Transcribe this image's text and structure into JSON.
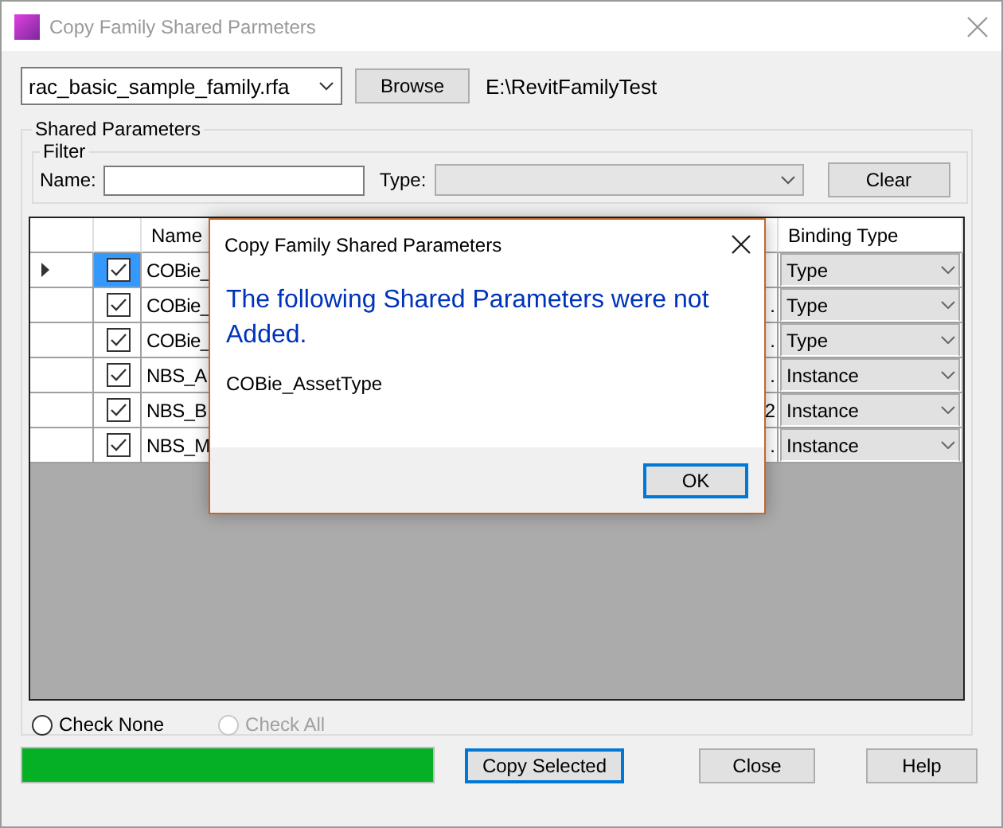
{
  "window": {
    "title": "Copy Family Shared Parmeters"
  },
  "file_select": {
    "value": "rac_basic_sample_family.rfa"
  },
  "browse_button": "Browse",
  "path": "E:\\RevitFamilyTest",
  "shared_parameters": {
    "title": "Shared Parameters",
    "filter": {
      "title": "Filter",
      "name_label": "Name:",
      "type_label": "Type:",
      "clear_button": "Clear"
    },
    "table": {
      "columns": [
        "Name",
        "Binding Type"
      ],
      "rows": [
        {
          "current": true,
          "selected": true,
          "checked": true,
          "name": "COBie_",
          "binding_type": "Type"
        },
        {
          "current": false,
          "selected": false,
          "checked": true,
          "name": "COBie_",
          "column_3": ".",
          "binding_type": "Type"
        },
        {
          "current": false,
          "selected": false,
          "checked": true,
          "name": "COBie_",
          "column_3": ".",
          "binding_type": "Type"
        },
        {
          "current": false,
          "selected": false,
          "checked": true,
          "name": "NBS_A",
          "column_3": ".",
          "binding_type": "Instance"
        },
        {
          "current": false,
          "selected": false,
          "checked": true,
          "name": "NBS_B",
          "column_3": "2",
          "binding_type": "Instance"
        },
        {
          "current": false,
          "selected": false,
          "checked": true,
          "name": "NBS_M",
          "column_3": ".",
          "binding_type": "Instance"
        }
      ]
    },
    "options": [
      {
        "label": "Check None",
        "selected": false,
        "disabled": false
      },
      {
        "label": "Check All",
        "selected": false,
        "disabled": true
      }
    ]
  },
  "progress": {
    "level": 1
  },
  "buttons": [
    {
      "label": "Copy Selected",
      "focused": true
    },
    {
      "label": "Close",
      "focused": false
    },
    {
      "label": "Help",
      "focused": false
    }
  ],
  "message_box": {
    "title": "Copy Family Shared Parameters",
    "message": "The following Shared Parameters were not Added.",
    "detail": "COBie_AssetType",
    "button": "OK"
  }
}
